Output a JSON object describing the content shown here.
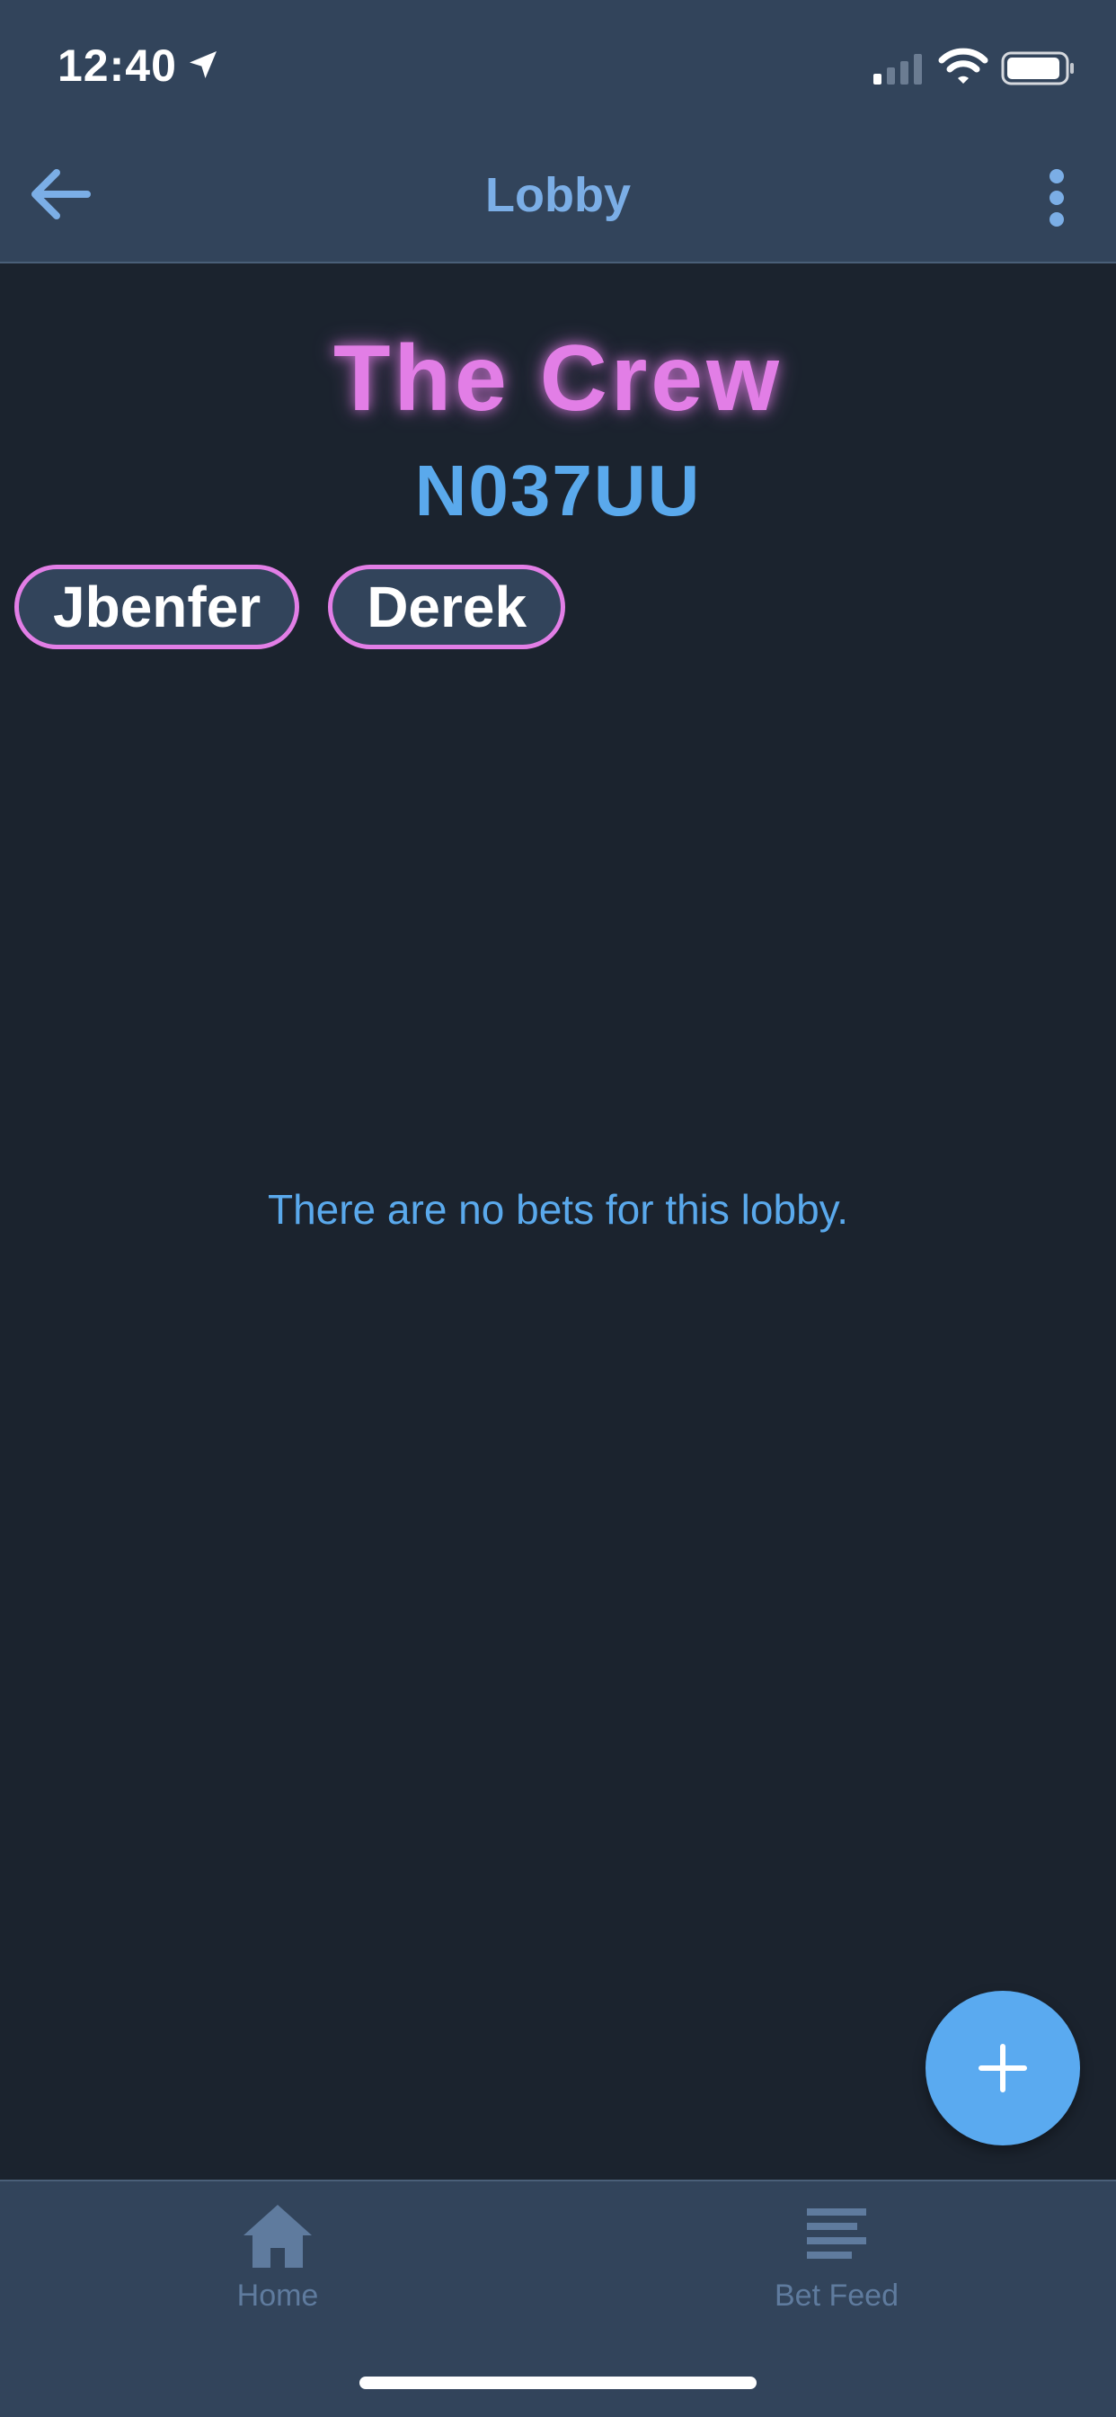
{
  "status_bar": {
    "time": "12:40"
  },
  "header": {
    "title": "Lobby",
    "back_icon": "arrow-left-icon",
    "more_icon": "vertical-dots-icon"
  },
  "lobby": {
    "name": "The Crew",
    "code": "N037UU",
    "members": [
      {
        "name": "Jbenfer"
      },
      {
        "name": "Derek"
      }
    ],
    "empty_message": "There are no bets for this lobby."
  },
  "fab": {
    "icon": "plus-icon"
  },
  "bottom_nav": {
    "items": [
      {
        "label": "Home",
        "icon": "home-icon"
      },
      {
        "label": "Bet Feed",
        "icon": "feed-icon"
      }
    ]
  },
  "colors": {
    "background": "#1b232e",
    "bar": "#32445b",
    "accent_pink": "#e27ee6",
    "accent_blue": "#5aa9ec",
    "nav_inactive": "#5f7b9e"
  }
}
